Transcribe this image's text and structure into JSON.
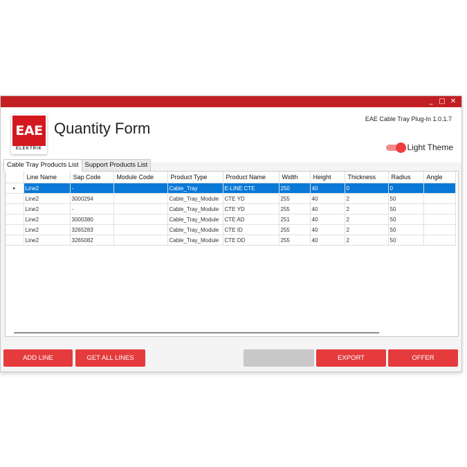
{
  "window": {
    "controls": [
      "_",
      "□",
      "✕"
    ],
    "titlebar_color": "#c11f24"
  },
  "header": {
    "logo_text": "EAE",
    "logo_subtext": "ELEKTRIK",
    "title": "Quantity Form",
    "version": "EAE Cable Tray Plug-In 1.0.1.7",
    "theme_label": "Light Theme",
    "theme_toggle_on": true
  },
  "tabs": [
    {
      "label": "Cable Tray Products List",
      "active": true
    },
    {
      "label": "Support Products List",
      "active": false
    }
  ],
  "table": {
    "columns": [
      "Line Name",
      "Sap Code",
      "Module Code",
      "Product Type",
      "Product Name",
      "Width",
      "Height",
      "Thickness",
      "Radius",
      "Angle"
    ],
    "rows": [
      [
        "Line2",
        "-",
        "",
        "Cable_Tray",
        "E-LINE CTE",
        "250",
        "40",
        "0",
        "0",
        ""
      ],
      [
        "Line2",
        "3000294",
        "",
        "Cable_Tray_Module",
        "CTE YD",
        "255",
        "40",
        "2",
        "50",
        ""
      ],
      [
        "Line2",
        "-",
        "",
        "Cable_Tray_Module",
        "CTE YD",
        "255",
        "40",
        "2",
        "50",
        ""
      ],
      [
        "Line2",
        "3000380",
        "",
        "Cable_Tray_Module",
        "CTE AD",
        "251",
        "40",
        "2",
        "50",
        ""
      ],
      [
        "Line2",
        "3265283",
        "",
        "Cable_Tray_Module",
        "CTE ID",
        "255",
        "40",
        "2",
        "50",
        ""
      ],
      [
        "Line2",
        "3265082",
        "",
        "Cable_Tray_Module",
        "CTE DD",
        "255",
        "40",
        "2",
        "50",
        ""
      ]
    ],
    "selected_row": 0,
    "row_indicator": "▸"
  },
  "buttons": {
    "add_line": "ADD LINE",
    "get_all_lines": "GET ALL LINES",
    "blank": "",
    "export": "EXPORT",
    "offer": "OFFER"
  },
  "colors": {
    "accent": "#e53b3d",
    "selection": "#0a78d7"
  }
}
